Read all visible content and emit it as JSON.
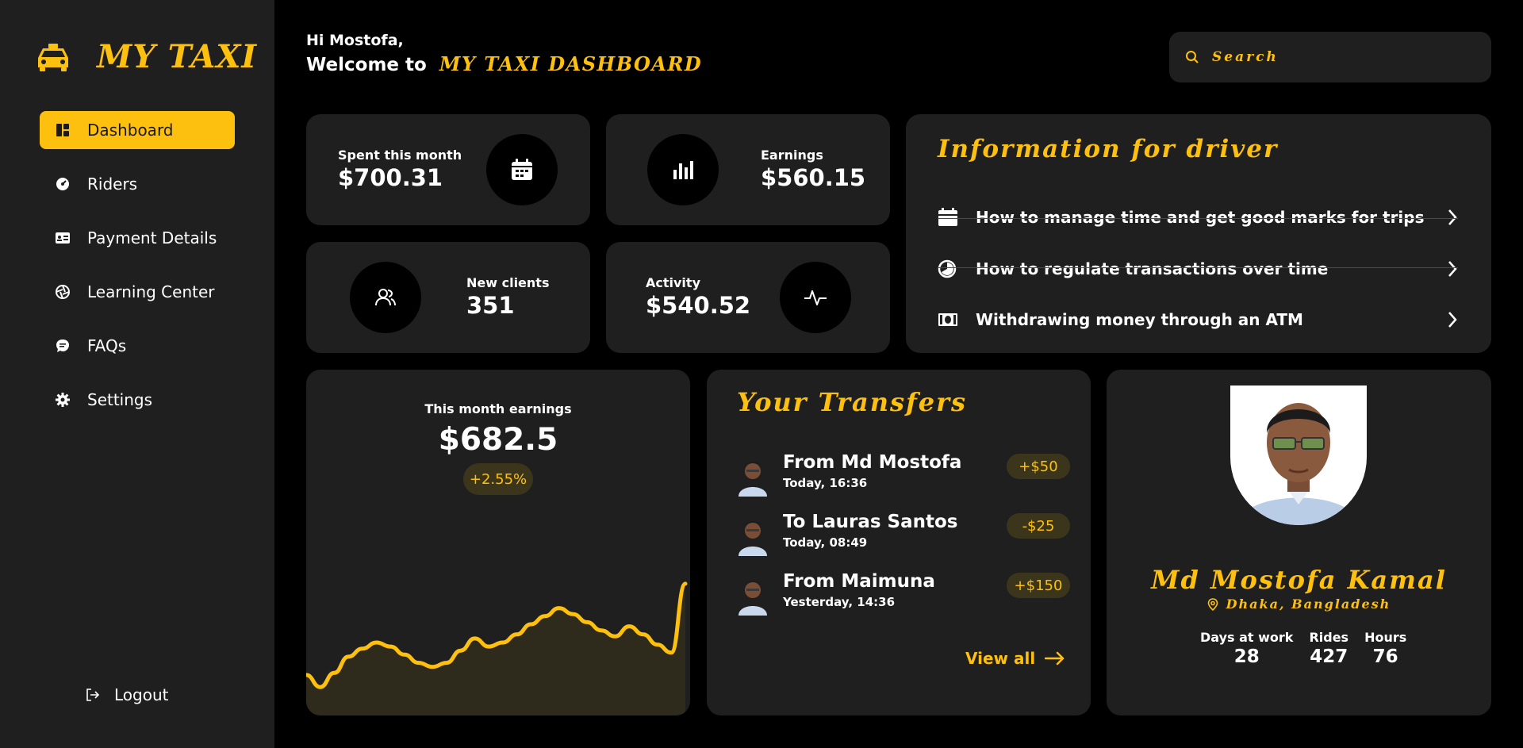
{
  "brand": {
    "name": "MY TAXI",
    "accent": "#fdc00f"
  },
  "sidebar": {
    "items": [
      {
        "label": "Dashboard",
        "icon": "dashboard-icon"
      },
      {
        "label": "Riders",
        "icon": "gauge-icon"
      },
      {
        "label": "Payment Details",
        "icon": "id-card-icon"
      },
      {
        "label": "Learning Center",
        "icon": "aperture-icon"
      },
      {
        "label": "FAQs",
        "icon": "chat-icon"
      },
      {
        "label": "Settings",
        "icon": "gear-icon"
      }
    ],
    "logout": "Logout"
  },
  "header": {
    "hi": "Hi Mostofa,",
    "welcome": "Welcome to",
    "brand": "MY TAXI DASHBOARD"
  },
  "search": {
    "placeholder": "Search"
  },
  "stats": {
    "spent": {
      "label": "Spent this month",
      "value": "$700.31"
    },
    "earnings": {
      "label": "Earnings",
      "value": "$560.15"
    },
    "clients": {
      "label": "New clients",
      "value": "351"
    },
    "activity": {
      "label": "Activity",
      "value": "$540.52"
    }
  },
  "info": {
    "title": "Information for driver",
    "items": [
      {
        "text": "How to manage time and get good marks for trips",
        "icon": "calendar-icon"
      },
      {
        "text": "How to regulate transactions over time",
        "icon": "pie-icon"
      },
      {
        "text": "Withdrawing money through an ATM",
        "icon": "cash-icon"
      }
    ]
  },
  "earnings_chart": {
    "label": "This month earnings",
    "value": "$682.5",
    "change": "+2.55%"
  },
  "chart_data": {
    "type": "area",
    "title": "",
    "values": [
      40,
      28,
      42,
      58,
      66,
      72,
      68,
      60,
      52,
      48,
      52,
      64,
      76,
      68,
      72,
      80,
      90,
      98,
      106,
      100,
      92,
      84,
      78,
      88,
      80,
      70,
      62,
      130
    ],
    "ylim": [
      0,
      180
    ]
  },
  "transfers": {
    "title": "Your Transfers",
    "items": [
      {
        "name": "From Md Mostofa",
        "time": "Today, 16:36",
        "amount": "+$50"
      },
      {
        "name": "To Lauras Santos",
        "time": "Today, 08:49",
        "amount": "-$25"
      },
      {
        "name": "From Maimuna",
        "time": "Yesterday, 14:36",
        "amount": "+$150"
      }
    ],
    "view_all": "View all"
  },
  "profile": {
    "name": "Md Mostofa Kamal",
    "location": "Dhaka, Bangladesh",
    "stats": [
      {
        "label": "Days at work",
        "value": "28"
      },
      {
        "label": "Rides",
        "value": "427"
      },
      {
        "label": "Hours",
        "value": "76"
      }
    ]
  }
}
